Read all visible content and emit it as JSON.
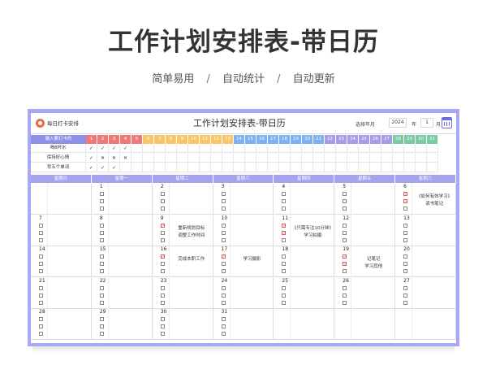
{
  "hero": {
    "title": "工作计划安排表-带日历",
    "tags": [
      "简单易用",
      "自动统计",
      "自动更新"
    ],
    "separator": "/"
  },
  "sheet": {
    "app_title": "每日打卡安排",
    "title": "工作计划安排表-带日历",
    "select_label": "选择年月",
    "year": "2024",
    "year_unit": "年",
    "month": "1",
    "month_unit": "月"
  },
  "habits": {
    "header_label": "输入要打卡的",
    "days": [
      "1",
      "2",
      "3",
      "4",
      "5",
      "6",
      "7",
      "8",
      "9",
      "10",
      "11",
      "12",
      "13",
      "14",
      "15",
      "16",
      "17",
      "18",
      "19",
      "20",
      "21",
      "22",
      "23",
      "24",
      "25",
      "26",
      "27",
      "28",
      "29",
      "30",
      "31"
    ],
    "day_colors": [
      "#f07a7a",
      "#f07a7a",
      "#f07a7a",
      "#f07a7a",
      "#f07a7a",
      "#f7c66b",
      "#f7c66b",
      "#f7c66b",
      "#f7c66b",
      "#f7c66b",
      "#f7c66b",
      "#f7c66b",
      "#f7c66b",
      "#7db1ef",
      "#7db1ef",
      "#7db1ef",
      "#7db1ef",
      "#7db1ef",
      "#7db1ef",
      "#7db1ef",
      "#7db1ef",
      "#a99be8",
      "#a99be8",
      "#a99be8",
      "#a99be8",
      "#a99be8",
      "#a99be8",
      "#7cc9a3",
      "#7cc9a3",
      "#7cc9a3",
      "#7cc9a3"
    ],
    "rows": [
      {
        "name": "喝8杯水",
        "marks": [
          "✓",
          "✓",
          "✓",
          "✓"
        ]
      },
      {
        "name": "保持好心情",
        "marks": [
          "✓",
          "✕",
          "✕",
          "✕"
        ]
      },
      {
        "name": "背五个单词",
        "marks": [
          "✓",
          "✓",
          "✓"
        ]
      }
    ]
  },
  "calendar": {
    "weekdays": [
      "星期日",
      "星期一",
      "星期二",
      "星期三",
      "星期四",
      "星期五",
      "星期六"
    ],
    "weeks": [
      [
        {
          "day": ""
        },
        {
          "day": "1"
        },
        {
          "day": "2"
        },
        {
          "day": "3"
        },
        {
          "day": "4"
        },
        {
          "day": "5"
        },
        {
          "day": "6",
          "checks": [
            true,
            true,
            false
          ],
          "notes": [
            "《如何有效学习》",
            "读书笔记"
          ]
        }
      ],
      [
        {
          "day": "7"
        },
        {
          "day": "8"
        },
        {
          "day": "9",
          "checks": [
            true,
            false,
            false
          ],
          "notes": [
            "重新规划目标",
            "调整工作时间"
          ]
        },
        {
          "day": "10"
        },
        {
          "day": "11",
          "checks": [
            true,
            true,
            false
          ],
          "notes": [
            "《只需专注10分钟》",
            "学习拍摄"
          ]
        },
        {
          "day": "12"
        },
        {
          "day": "13"
        }
      ],
      [
        {
          "day": "14"
        },
        {
          "day": "15"
        },
        {
          "day": "16",
          "checks": [
            true,
            false,
            false
          ],
          "notes": [
            "完成本职工作"
          ]
        },
        {
          "day": "17",
          "checks": [
            true,
            false,
            false
          ],
          "notes": [
            "学习摄影"
          ]
        },
        {
          "day": "18"
        },
        {
          "day": "19",
          "checks": [
            true,
            true,
            false
          ],
          "notes": [
            "记笔记",
            "学习其他"
          ]
        },
        {
          "day": "20"
        }
      ],
      [
        {
          "day": "21"
        },
        {
          "day": "22"
        },
        {
          "day": "23"
        },
        {
          "day": "24"
        },
        {
          "day": "25"
        },
        {
          "day": "26"
        },
        {
          "day": "27"
        }
      ],
      [
        {
          "day": "28"
        },
        {
          "day": "29"
        },
        {
          "day": "30"
        },
        {
          "day": "31"
        },
        {
          "day": ""
        },
        {
          "day": ""
        },
        {
          "day": ""
        }
      ]
    ]
  }
}
